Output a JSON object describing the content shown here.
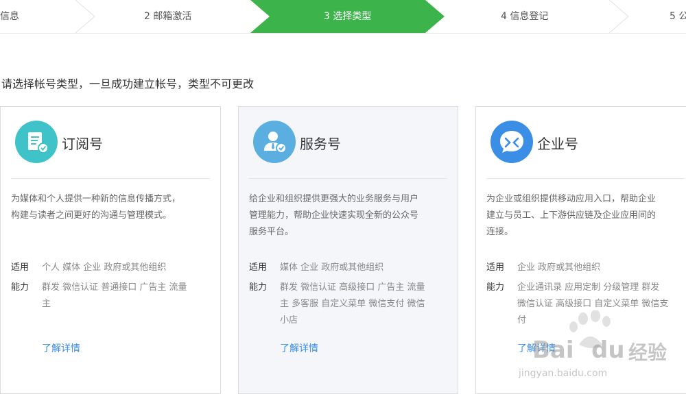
{
  "steps": [
    {
      "label": "信息"
    },
    {
      "label": "2 邮箱激活"
    },
    {
      "label": "3 选择类型"
    },
    {
      "label": "4 信息登记"
    },
    {
      "label": "5 公"
    }
  ],
  "active_step": 2,
  "accent_color": "#3cb44b",
  "link_color": "#3a8ee6",
  "prompt": "请选择帐号类型，一旦成功建立帐号，类型不可更改",
  "cards": [
    {
      "title": "订阅号",
      "icon": "subscription-document-icon",
      "icon_color": "#3fc3c9",
      "desc_lines": [
        "为媒体和个人提供一种新的信息传播方式，",
        "构建与读者之间更好的沟通与管理模式。"
      ],
      "for_label": "适用",
      "for_value": "个人 媒体 企业 政府或其他组织",
      "ability_label": "能力",
      "ability_lines": [
        "群发 微信认证 普通接口 广告主 流量",
        "主"
      ],
      "details": "了解详情"
    },
    {
      "title": "服务号",
      "icon": "service-person-icon",
      "icon_color": "#5aaee0",
      "desc_lines": [
        "给企业和组织提供更强大的业务服务与用户",
        "管理能力，帮助企业快速实现全新的公众号",
        "服务平台。"
      ],
      "for_label": "适用",
      "for_value": "媒体 企业 政府或其他组织",
      "ability_label": "能力",
      "ability_lines": [
        "群发 微信认证 高级接口 广告主 流量",
        "主 多客服 自定义菜单 微信支付 微信",
        "小店"
      ],
      "details": "了解详情"
    },
    {
      "title": "企业号",
      "icon": "enterprise-chat-icon",
      "icon_color": "#3a8ee6",
      "desc_lines": [
        "为企业或组织提供移动应用入口，帮助企业",
        "建立与员工、上下游供应链及企业应用间的",
        "连接。"
      ],
      "for_label": "适用",
      "for_value": "企业 政府或其他组织",
      "ability_label": "能力",
      "ability_lines": [
        "企业通讯录 应用定制 分级管理 群发",
        "微信认证 高级接口 自定义菜单 微信支",
        "付"
      ],
      "details": "了解详情"
    }
  ],
  "watermark": {
    "brand_left": "Bai",
    "brand_right": "du",
    "brand_cn": "经验",
    "url": "jingyan.baidu.com"
  }
}
